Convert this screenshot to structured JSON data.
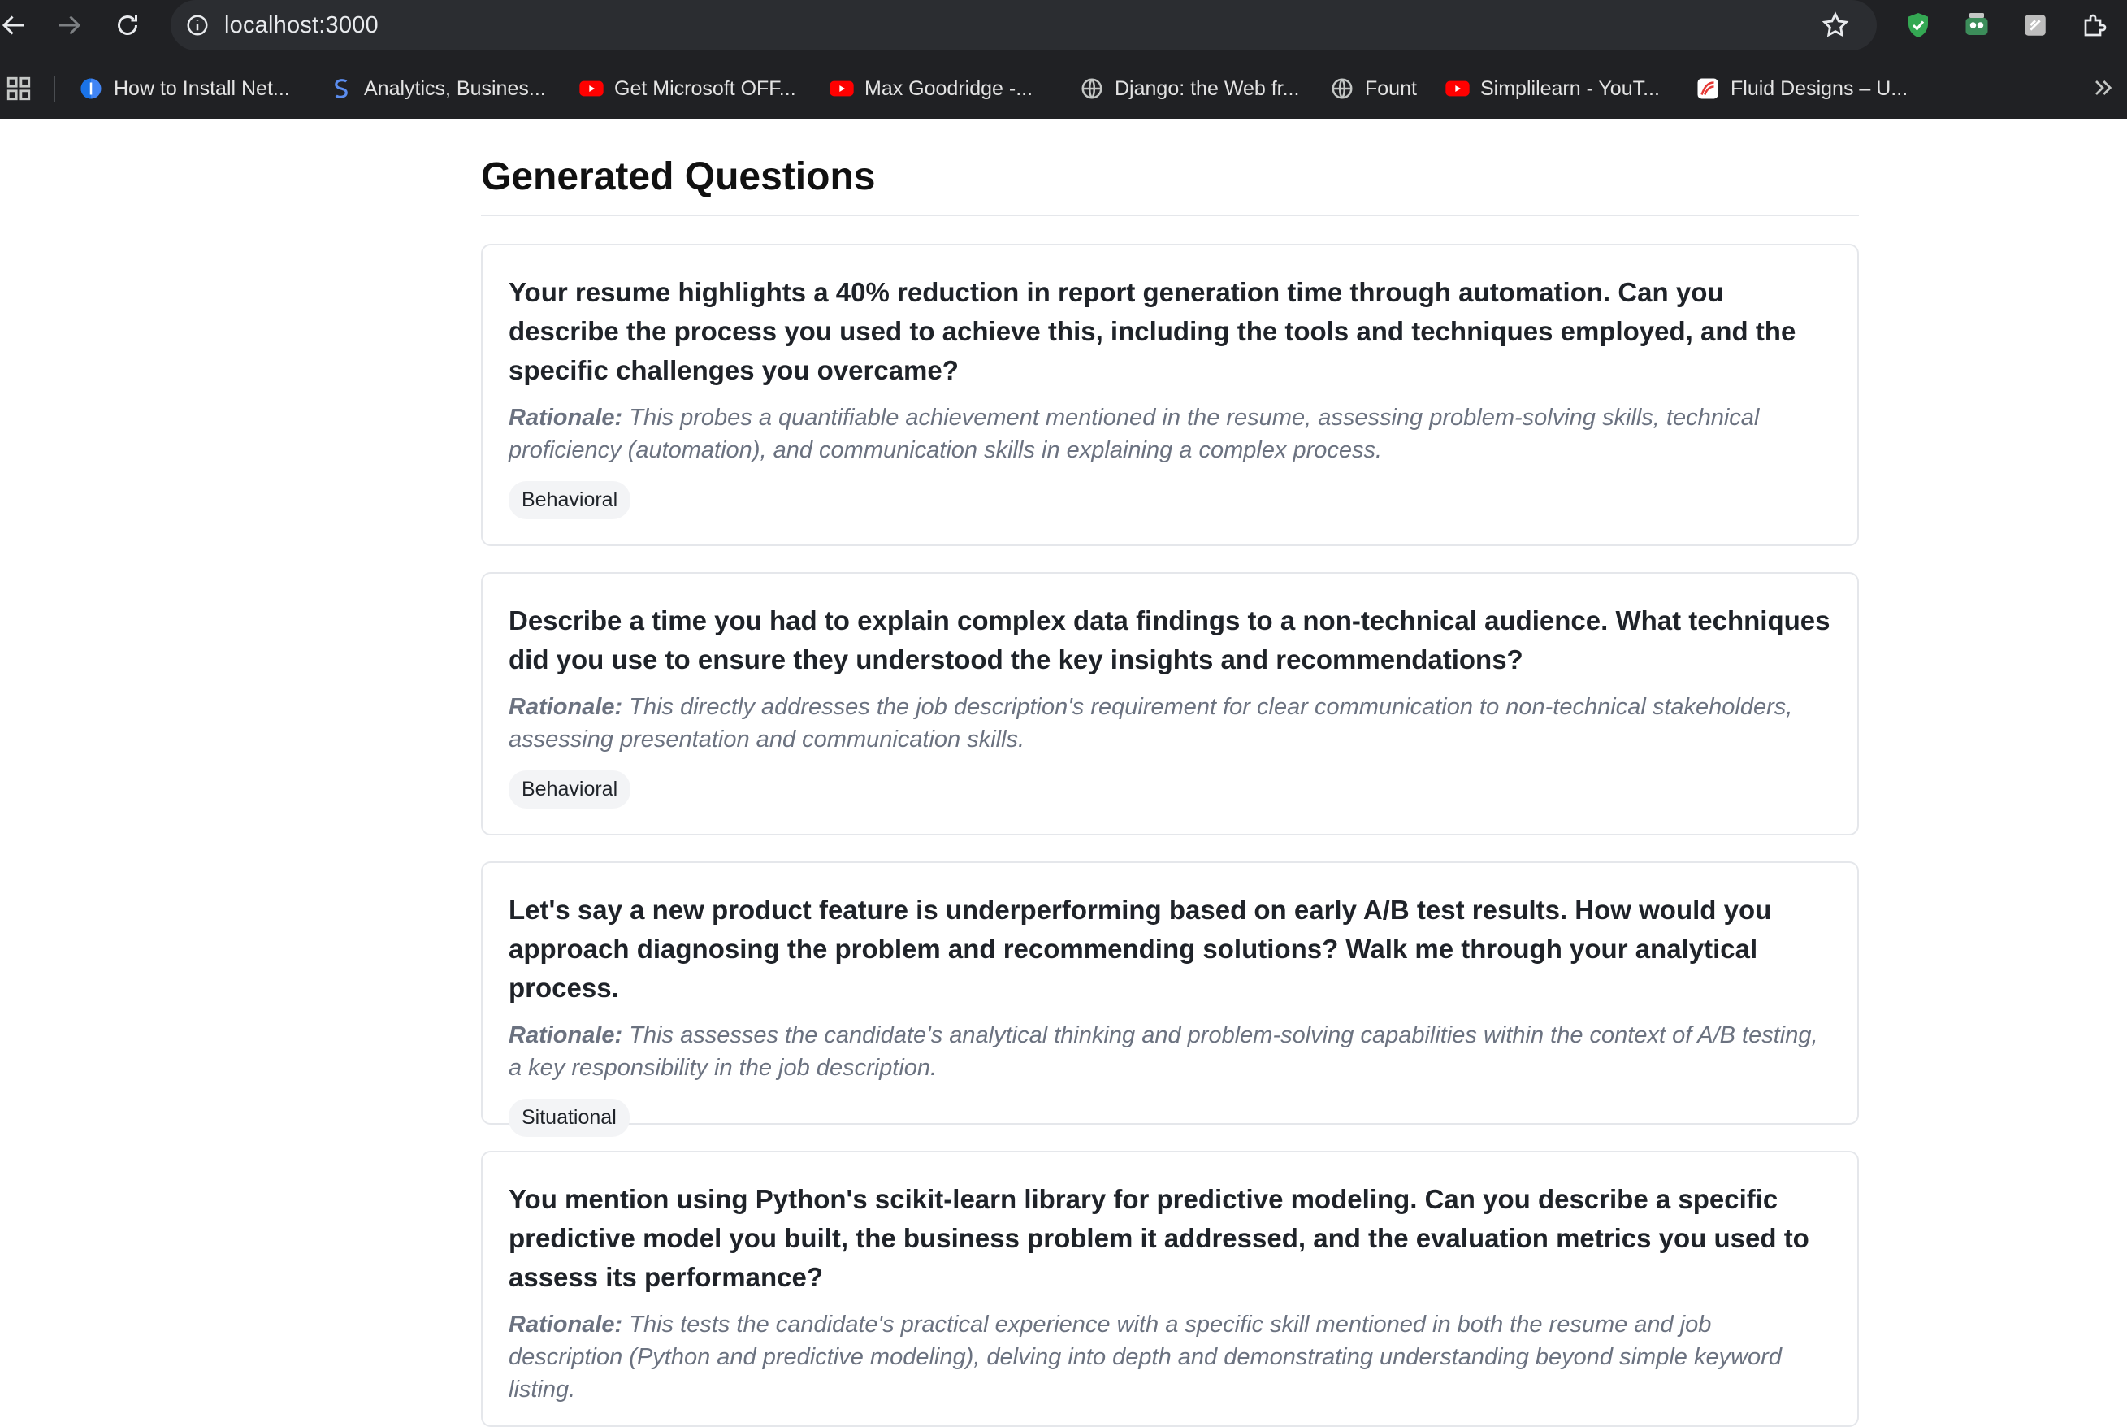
{
  "browser": {
    "url": "localhost:3000",
    "bookmarks": [
      {
        "label": "How to Install Net...",
        "icon": "globe-blue-icon"
      },
      {
        "label": "Analytics, Busines...",
        "icon": "s-logo-icon"
      },
      {
        "label": "Get Microsoft OFF...",
        "icon": "youtube-icon"
      },
      {
        "label": "Max Goodridge -...",
        "icon": "youtube-icon"
      },
      {
        "label": "Django: the Web fr...",
        "icon": "globe-icon"
      },
      {
        "label": "Fount",
        "icon": "globe-icon"
      },
      {
        "label": "Simplilearn - YouT...",
        "icon": "youtube-icon"
      },
      {
        "label": "Fluid Designs – U...",
        "icon": "fluid-logo-icon"
      }
    ]
  },
  "page": {
    "title": "Generated Questions",
    "rationale_label": "Rationale:",
    "questions": [
      {
        "question": "Your resume highlights a 40% reduction in report generation time through automation. Can you describe the process you used to achieve this, including the tools and techniques employed, and the specific challenges you overcame?",
        "rationale": "This probes a quantifiable achievement mentioned in the resume, assessing problem-solving skills, technical proficiency (automation), and communication skills in explaining a complex process.",
        "tag": "Behavioral"
      },
      {
        "question": "Describe a time you had to explain complex data findings to a non-technical audience. What techniques did you use to ensure they understood the key insights and recommendations?",
        "rationale": "This directly addresses the job description's requirement for clear communication to non-technical stakeholders, assessing presentation and communication skills.",
        "tag": "Behavioral"
      },
      {
        "question": "Let's say a new product feature is underperforming based on early A/B test results. How would you approach diagnosing the problem and recommending solutions? Walk me through your analytical process.",
        "rationale": "This assesses the candidate's analytical thinking and problem-solving capabilities within the context of A/B testing, a key responsibility in the job description.",
        "tag": "Situational"
      },
      {
        "question": "You mention using Python's scikit-learn library for predictive modeling. Can you describe a specific predictive model you built, the business problem it addressed, and the evaluation metrics you used to assess its performance?",
        "rationale": "This tests the candidate's practical experience with a specific skill mentioned in both the resume and job description (Python and predictive modeling), delving into depth and demonstrating understanding beyond simple keyword listing.",
        "tag": ""
      }
    ]
  }
}
